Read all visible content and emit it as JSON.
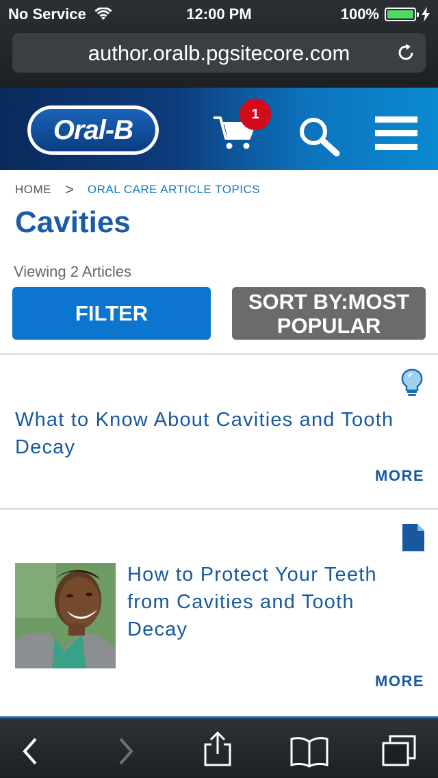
{
  "status_bar": {
    "carrier": "No Service",
    "time": "12:00 PM",
    "battery": "100%",
    "battery_level": 1.0
  },
  "url_bar": {
    "url": "author.oralb.pgsitecore.com"
  },
  "header": {
    "logo_text": "Oral-B",
    "cart_count": "1"
  },
  "breadcrumb": {
    "home": "HOME",
    "separator": ">",
    "current": "ORAL CARE ARTICLE TOPICS"
  },
  "page": {
    "title": "Cavities",
    "viewing": "Viewing 2 Articles",
    "filter_label": "FILTER",
    "sort_label": "SORT BY:MOST POPULAR"
  },
  "articles": [
    {
      "type_icon": "lightbulb-icon",
      "title": "What to Know About Cavities and Tooth Decay",
      "more": "MORE"
    },
    {
      "type_icon": "document-icon",
      "title": "How to Protect Your Teeth from Cavities and Tooth Decay",
      "more": "MORE"
    }
  ],
  "colors": {
    "accent_blue": "#0c75cf",
    "title_blue": "#17589e",
    "sort_gray": "#6b6b6b",
    "badge_red": "#d40a1a"
  }
}
